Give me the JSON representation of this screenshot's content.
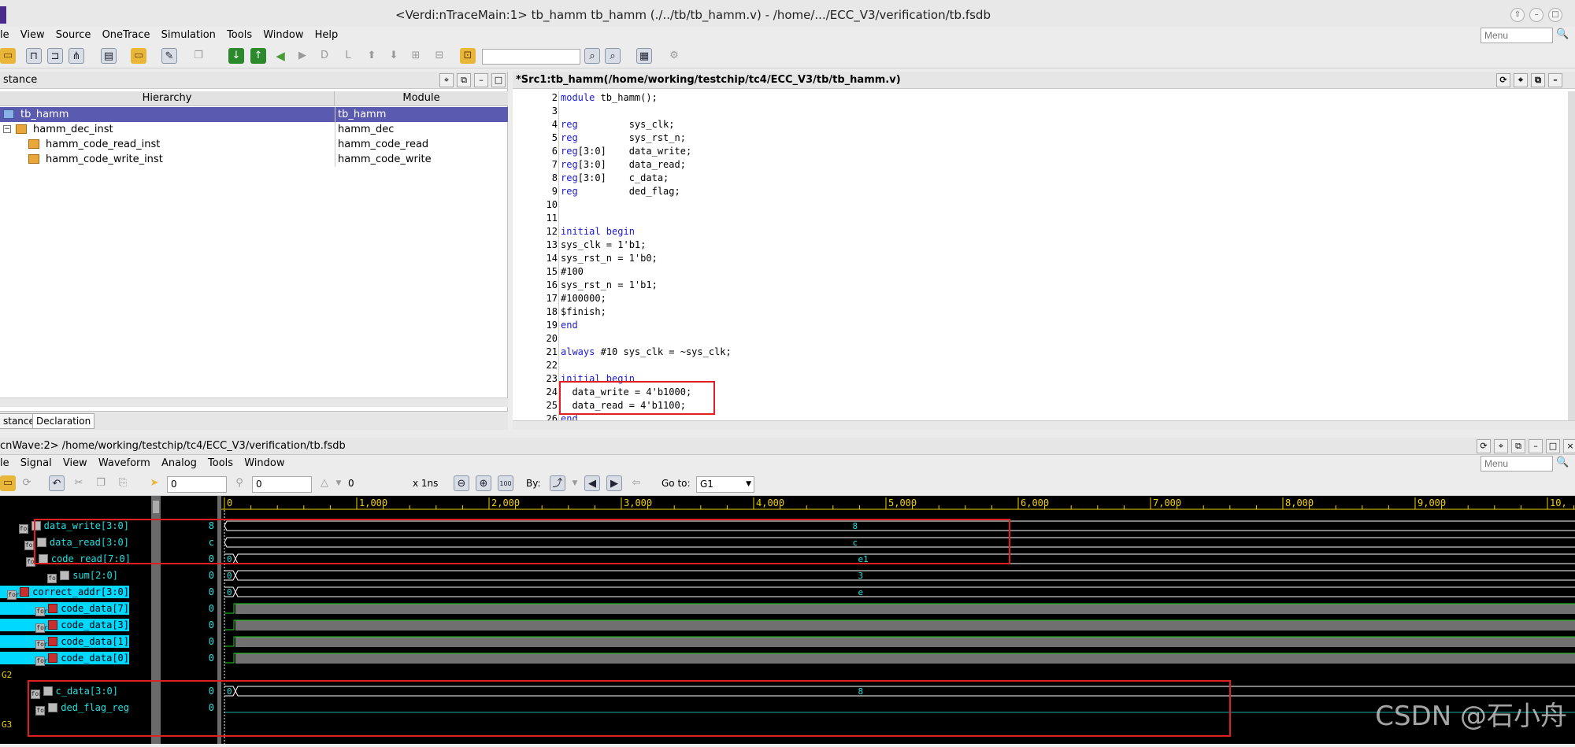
{
  "window": {
    "title": "<Verdi:nTraceMain:1> tb_hamm tb_hamm (./../tb/tb_hamm.v) - /home/.../ECC_V3/verification/tb.fsdb"
  },
  "main_menu": {
    "items": [
      "le",
      "View",
      "Source",
      "OneTrace",
      "Simulation",
      "Tools",
      "Window",
      "Help"
    ],
    "search_placeholder": "Menu"
  },
  "instance_panel": {
    "title": "stance",
    "columns": {
      "hierarchy": "Hierarchy",
      "module": "Module"
    },
    "rows": [
      {
        "name": "tb_hamm",
        "module": "tb_hamm",
        "selected": true
      },
      {
        "name": "hamm_dec_inst",
        "module": "hamm_dec",
        "selected": false
      },
      {
        "name": "hamm_code_read_inst",
        "module": "hamm_code_read",
        "selected": false
      },
      {
        "name": "hamm_code_write_inst",
        "module": "hamm_code_write",
        "selected": false
      }
    ],
    "tabs": [
      "stance",
      "Declaration"
    ]
  },
  "source_panel": {
    "title": "*Src1:tb_hamm(/home/working/testchip/tc4/ECC_V3/tb/tb_hamm.v)",
    "lines": [
      {
        "n": "2",
        "text": "module tb_hamm();"
      },
      {
        "n": "3",
        "text": ""
      },
      {
        "n": "4",
        "text": "reg         sys_clk;"
      },
      {
        "n": "5",
        "text": "reg         sys_rst_n;"
      },
      {
        "n": "6",
        "text": "reg[3:0]    data_write;"
      },
      {
        "n": "7",
        "text": "reg[3:0]    data_read;"
      },
      {
        "n": "8",
        "text": "reg[3:0]    c_data;"
      },
      {
        "n": "9",
        "text": "reg         ded_flag;"
      },
      {
        "n": "10",
        "text": ""
      },
      {
        "n": "11",
        "text": ""
      },
      {
        "n": "12",
        "text": "initial begin"
      },
      {
        "n": "13",
        "text": "sys_clk = 1'b1;"
      },
      {
        "n": "14",
        "text": "sys_rst_n = 1'b0;"
      },
      {
        "n": "15",
        "text": "#100"
      },
      {
        "n": "16",
        "text": "sys_rst_n = 1'b1;"
      },
      {
        "n": "17",
        "text": "#100000;"
      },
      {
        "n": "18",
        "text": "$finish;"
      },
      {
        "n": "19",
        "text": "end"
      },
      {
        "n": "20",
        "text": ""
      },
      {
        "n": "21",
        "text": "always #10 sys_clk = ~sys_clk;"
      },
      {
        "n": "22",
        "text": ""
      },
      {
        "n": "23",
        "text": "initial begin"
      },
      {
        "n": "24",
        "text": "  data_write = 4'b1000;"
      },
      {
        "n": "25",
        "text": "  data_read = 4'b1100;"
      },
      {
        "n": "26",
        "text": "end"
      }
    ]
  },
  "nwave": {
    "title": "cnWave:2> /home/working/testchip/tc4/ECC_V3/verification/tb.fsdb",
    "menu": [
      "le",
      "Signal",
      "View",
      "Waveform",
      "Analog",
      "Tools",
      "Window"
    ],
    "search_placeholder": "Menu",
    "toolbar": {
      "cursor_time": "0",
      "marker_time": "0",
      "delta": "0",
      "unit": "x 1ns",
      "by_label": "By:",
      "goto_label": "Go to:",
      "goto_value": "G1"
    },
    "timeline": [
      "0",
      "1,000",
      "2,000",
      "3,000",
      "4,000",
      "5,000",
      "6,000",
      "7,000",
      "8,000",
      "9,000",
      "10,"
    ],
    "signals": [
      {
        "name": "data_write[3:0]",
        "value": "8",
        "wave": "8",
        "highlight": false,
        "bus": true
      },
      {
        "name": "data_read[3:0]",
        "value": "c",
        "wave": "c",
        "highlight": false,
        "bus": true
      },
      {
        "name": "code_read[7:0]",
        "value": "0",
        "wave": "e1",
        "highlight": false,
        "bus": true
      },
      {
        "name": "sum[2:0]",
        "value": "0",
        "wave": "3",
        "highlight": false,
        "bus": true
      },
      {
        "name": "correct_addr[3:0]",
        "value": "0",
        "wave": "e",
        "highlight": true,
        "bus": true
      },
      {
        "name": "code_data[7]",
        "value": "0",
        "wave": "",
        "highlight": true,
        "bus": false
      },
      {
        "name": "code_data[3]",
        "value": "0",
        "wave": "",
        "highlight": true,
        "bus": false
      },
      {
        "name": "code_data[1]",
        "value": "0",
        "wave": "",
        "highlight": true,
        "bus": false
      },
      {
        "name": "code_data[0]",
        "value": "0",
        "wave": "",
        "highlight": true,
        "bus": false
      },
      {
        "name": "G2",
        "value": "",
        "wave": "",
        "group": true
      },
      {
        "name": "c_data[3:0]",
        "value": "0",
        "wave": "8",
        "highlight": false,
        "bus": true
      },
      {
        "name": "ded_flag_reg",
        "value": "0",
        "wave": "",
        "highlight": false,
        "bus": false
      },
      {
        "name": "G3",
        "value": "",
        "wave": "",
        "group": true
      }
    ]
  },
  "watermark": "CSDN @石小舟",
  "colors": {
    "signal": "#23e0e0",
    "highlight": "#00d8ff",
    "annotation": "#e02020",
    "selection": "#5a5ab0"
  }
}
